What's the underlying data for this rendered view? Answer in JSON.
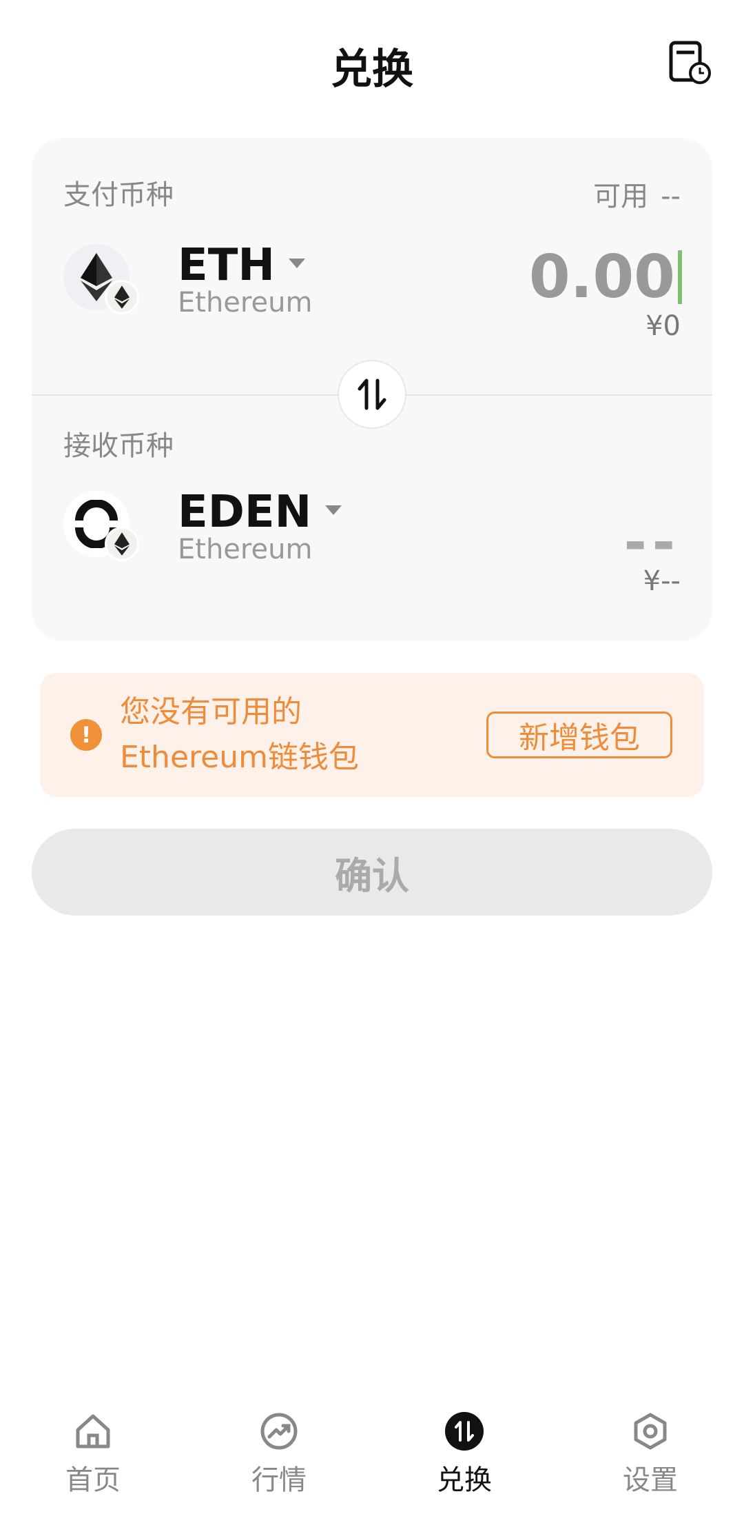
{
  "header": {
    "title": "兑换"
  },
  "pay": {
    "label": "支付币种",
    "available_label": "可用",
    "available_value": "--",
    "symbol": "ETH",
    "chain": "Ethereum",
    "amount": "0.00",
    "fiat": "¥0"
  },
  "receive": {
    "label": "接收币种",
    "symbol": "EDEN",
    "chain": "Ethereum",
    "amount": "--",
    "fiat": "¥--"
  },
  "warning": {
    "line1": "您没有可用的",
    "line2": "Ethereum链钱包",
    "button": "新增钱包"
  },
  "confirm": {
    "label": "确认"
  },
  "tabs": [
    {
      "label": "首页",
      "icon": "home-icon"
    },
    {
      "label": "行情",
      "icon": "market-trend-icon"
    },
    {
      "label": "兑换",
      "icon": "swap-icon"
    },
    {
      "label": "设置",
      "icon": "settings-icon"
    }
  ],
  "colors": {
    "accent_orange": "#ef8c3b",
    "warning_bg": "#fdf1ea",
    "cursor_green": "#7cc16d"
  }
}
